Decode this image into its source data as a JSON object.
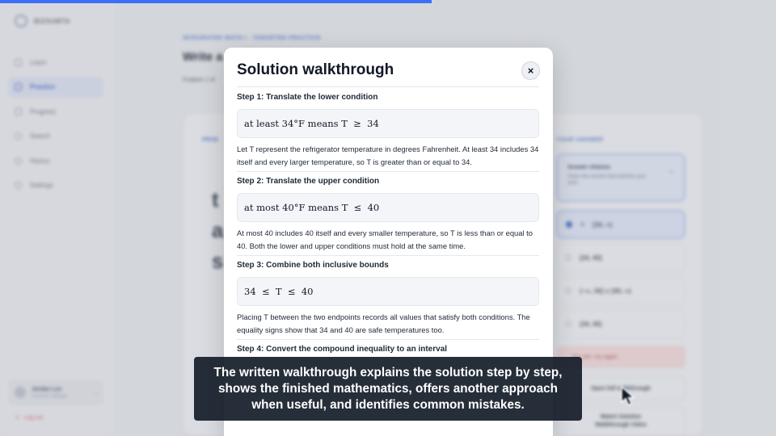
{
  "progress": 0.556,
  "sidebar": {
    "brand": "BIZSUMTA",
    "items": [
      {
        "label": "Learn",
        "icon": "book-icon",
        "active": false
      },
      {
        "label": "Practice",
        "icon": "pencil-icon",
        "active": true
      },
      {
        "label": "Progress",
        "icon": "chart-icon",
        "active": false
      },
      {
        "label": "Search",
        "icon": "search-icon",
        "active": false
      },
      {
        "label": "History",
        "icon": "history-icon",
        "active": false
      },
      {
        "label": "Settings",
        "icon": "gear-icon",
        "active": false
      }
    ],
    "user_name": "Jordan Lee",
    "user_sub": "Account settings",
    "logout": "Log out"
  },
  "background": {
    "breadcrumb": "INTEGRATED MATH I · TARGETED PRACTICE",
    "title": "Write a",
    "problem_label": "Problem 1 of",
    "card_label": "PROB",
    "big_lines": [
      "t",
      "a",
      "s"
    ],
    "your_answer": "YOUR ANSWER",
    "answer_choices_title": "Answer choices",
    "answer_choices_sub": "Select the answer that matches your work.",
    "options": [
      {
        "key": "A",
        "label": "[34, ∞)",
        "selected": true
      },
      {
        "key": "",
        "label": "[34, 40]",
        "selected": false
      },
      {
        "key": "",
        "label": "(−∞, 34] ∪ [40, ∞)",
        "selected": false
      },
      {
        "key": "",
        "label": "(34, 40)",
        "selected": false
      }
    ],
    "feedback": "Not yet—try again",
    "walkthrough_button": "Open full walkthrough",
    "video_button_line1": "Watch Solution",
    "video_button_line2": "Walkthrough Video"
  },
  "modal": {
    "title": "Solution walkthrough",
    "close_label": "×",
    "steps": [
      {
        "title": "Step 1: Translate the lower condition",
        "formula": "at least 34°F means T  ≥  34",
        "text": "Let T represent the refrigerator temperature in degrees Fahrenheit. At least 34 includes 34 itself and every larger temperature, so T is greater than or equal to 34."
      },
      {
        "title": "Step 2: Translate the upper condition",
        "formula": "at most 40°F means T  ≤  40",
        "text": "At most 40 includes 40 itself and every smaller temperature, so T is less than or equal to 40. Both the lower and upper conditions must hold at the same time."
      },
      {
        "title": "Step 3: Combine both inclusive bounds",
        "formula": "34  ≤  T  ≤  40",
        "text": "Placing T between the two endpoints records all values that satisfy both conditions. The equality signs show that 34 and 40 are safe temperatures too."
      },
      {
        "title": "Step 4: Convert the compound inequality to an interval",
        "formula": "",
        "text": ""
      }
    ]
  },
  "caption": {
    "line1": "The written walkthrough explains the solution step by step,",
    "line2": "shows the finished mathematics, offers another approach",
    "line3": "when useful, and identifies common mistakes."
  },
  "colors": {
    "accent": "#3b6ff5",
    "caption_bg": "#161e2a"
  }
}
